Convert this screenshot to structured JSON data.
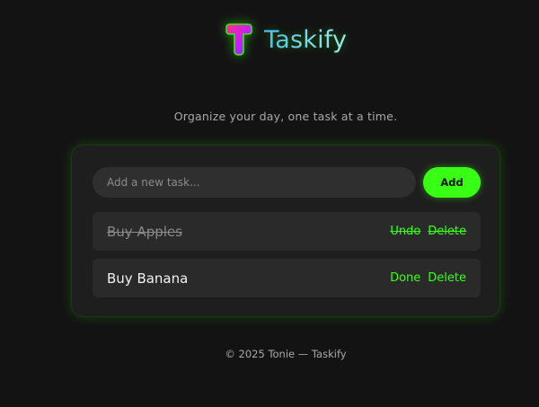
{
  "brand": {
    "name": "Taskify",
    "icon": "t-logo-icon",
    "accent": "#39ff14"
  },
  "tagline": "Organize your day, one task at a time.",
  "new_task": {
    "placeholder": "Add a new task...",
    "value": "",
    "add_label": "Add"
  },
  "tasks": [
    {
      "text": "Buy Apples",
      "completed": true,
      "toggle_label": "Undo",
      "delete_label": "Delete"
    },
    {
      "text": "Buy Banana",
      "completed": false,
      "toggle_label": "Done",
      "delete_label": "Delete"
    }
  ],
  "footer": "© 2025 Tonie — Taskify"
}
